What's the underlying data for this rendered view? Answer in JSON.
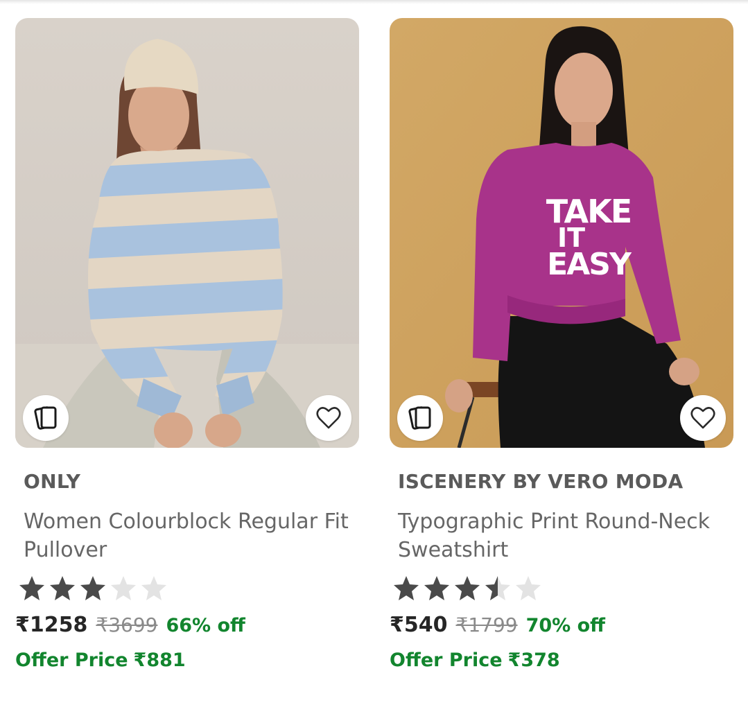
{
  "products": [
    {
      "brand": "ONLY",
      "title": "Women Colourblock Regular Fit Pullover",
      "rating": 3,
      "price": "₹1258",
      "mrp": "₹3699",
      "discount": "66% off",
      "offer_label": "Offer Price",
      "offer_price": "₹881",
      "image_desc_icon": "similar-products-icon",
      "wishlist_icon": "heart-icon"
    },
    {
      "brand": "ISCENERY BY VERO MODA",
      "title": "Typographic Print Round-Neck Sweatshirt",
      "rating": 3.5,
      "price": "₹540",
      "mrp": "₹1799",
      "discount": "70% off",
      "offer_label": "Offer Price",
      "offer_price": "₹378",
      "print_text": [
        "TAKE",
        "IT",
        "EASY"
      ],
      "image_desc_icon": "similar-products-icon",
      "wishlist_icon": "heart-icon"
    }
  ],
  "colors": {
    "star_filled": "#4a4a4a",
    "star_empty": "#e3e3e3",
    "discount_green": "#12852e"
  }
}
